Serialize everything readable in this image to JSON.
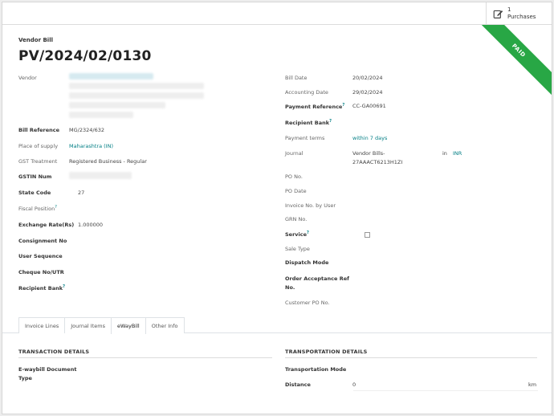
{
  "smart_button": {
    "count": "1",
    "label": "Purchases"
  },
  "ribbon": "PAID",
  "header": {
    "type_label": "Vendor Bill",
    "title": "PV/2024/02/0130"
  },
  "left_fields": {
    "vendor_label": "Vendor",
    "bill_reference_label": "Bill Reference",
    "bill_reference": "MG/2324/632",
    "place_of_supply_label": "Place of supply",
    "place_of_supply": "Maharashtra (IN)",
    "gst_treatment_label": "GST Treatment",
    "gst_treatment": "Registered Business - Regular",
    "gstin_label": "GSTIN Num",
    "state_code_label": "State Code",
    "state_code": "27",
    "fiscal_position_label": "Fiscal Position",
    "exchange_rate_label": "Exchange Rate(Rs)",
    "exchange_rate": "1.000000",
    "consignment_label": "Consignment No",
    "user_sequence_label": "User Sequence",
    "cheque_label": "Cheque No/UTR",
    "recipient_bank_label": "Recipient Bank"
  },
  "right_fields": {
    "bill_date_label": "Bill Date",
    "bill_date": "20/02/2024",
    "accounting_date_label": "Accounting Date",
    "accounting_date": "29/02/2024",
    "payment_reference_label": "Payment Reference",
    "payment_reference": "CC-GA00691",
    "recipient_bank_label": "Recipient Bank",
    "payment_terms_label": "Payment terms",
    "payment_terms": "within 7 days",
    "journal_label": "Journal",
    "journal_line1": "Vendor Bills-",
    "journal_line2": "27AAACT6213H1ZI",
    "journal_in": "in",
    "currency": "INR",
    "po_no_label": "PO No.",
    "po_date_label": "PO Date",
    "invoice_no_user_label": "Invoice No. by User",
    "grn_label": "GRN No.",
    "service_label": "Service",
    "sale_type_label": "Sale Type",
    "dispatch_mode_label": "Dispatch Mode",
    "order_ack_label_1": "Order Acceptance Ref",
    "order_ack_label_2": "No.",
    "customer_po_label": "Customer PO No."
  },
  "tabs": [
    "Invoice Lines",
    "Journal Items",
    "eWayBill",
    "Other Info"
  ],
  "active_tab": "eWayBill",
  "eway": {
    "transaction_title": "TRANSACTION DETAILS",
    "doc_type_label_1": "E-waybill Document",
    "doc_type_label_2": "Type",
    "transport_title": "TRANSPORTATION DETAILS",
    "transport_mode_label": "Transportation Mode",
    "distance_label": "Distance",
    "distance": "0",
    "distance_unit": "km"
  },
  "colors": {
    "accent": "#017e84",
    "ribbon": "#28a745"
  }
}
